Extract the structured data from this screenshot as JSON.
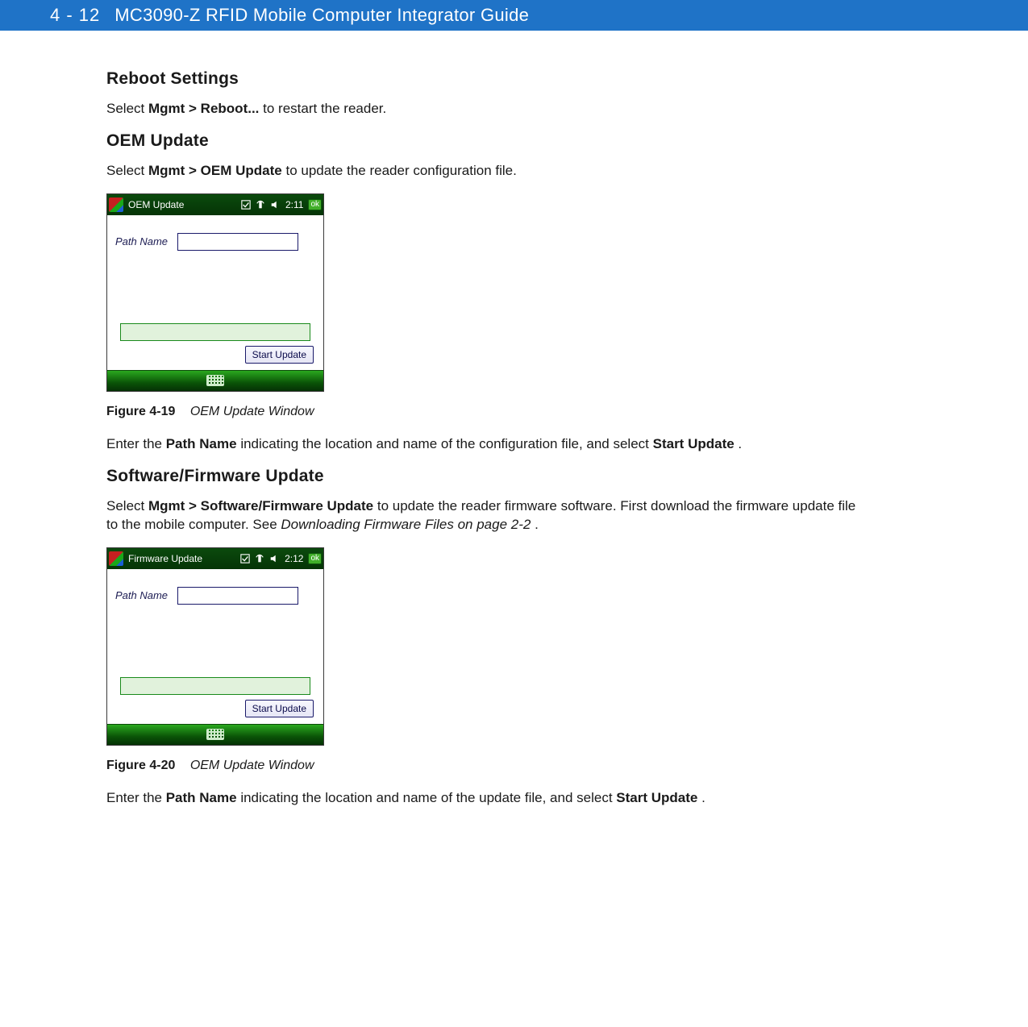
{
  "header": {
    "page_number": "4 - 12",
    "doc_title": "MC3090-Z RFID Mobile Computer Integrator Guide"
  },
  "sections": {
    "reboot": {
      "heading": "Reboot Settings",
      "para_pre": "Select ",
      "para_bold": "Mgmt > Reboot...",
      "para_post": " to restart the reader."
    },
    "oem": {
      "heading": "OEM Update",
      "para_pre": "Select ",
      "para_bold": "Mgmt > OEM Update",
      "para_post": " to update the reader configuration file."
    },
    "oem_after": {
      "pre": "Enter the ",
      "b1": "Path Name",
      "mid": " indicating the location and name of the configuration file, and select ",
      "b2": "Start Update",
      "post": "."
    },
    "fw": {
      "heading": "Software/Firmware Update",
      "pre": "Select ",
      "b1": "Mgmt > Software/Firmware Update",
      "mid": " to update the reader firmware software. First download the firmware update file to the mobile computer. See ",
      "ital": "Downloading Firmware Files on page 2-2",
      "post": "."
    },
    "fw_after": {
      "pre": "Enter the ",
      "b1": "Path Name",
      "mid": " indicating the location and name of the update file, and select ",
      "b2": "Start Update",
      "post": "."
    }
  },
  "figures": {
    "f1": {
      "num": "Figure 4-19",
      "title": "OEM Update Window"
    },
    "f2": {
      "num": "Figure 4-20",
      "title": "OEM Update Window"
    }
  },
  "device1": {
    "title": "OEM Update",
    "time": "2:11",
    "ok": "ok",
    "path_label": "Path Name",
    "start_label": "Start Update"
  },
  "device2": {
    "title": "Firmware Update",
    "time": "2:12",
    "ok": "ok",
    "path_label": "Path Name",
    "start_label": "Start Update"
  }
}
